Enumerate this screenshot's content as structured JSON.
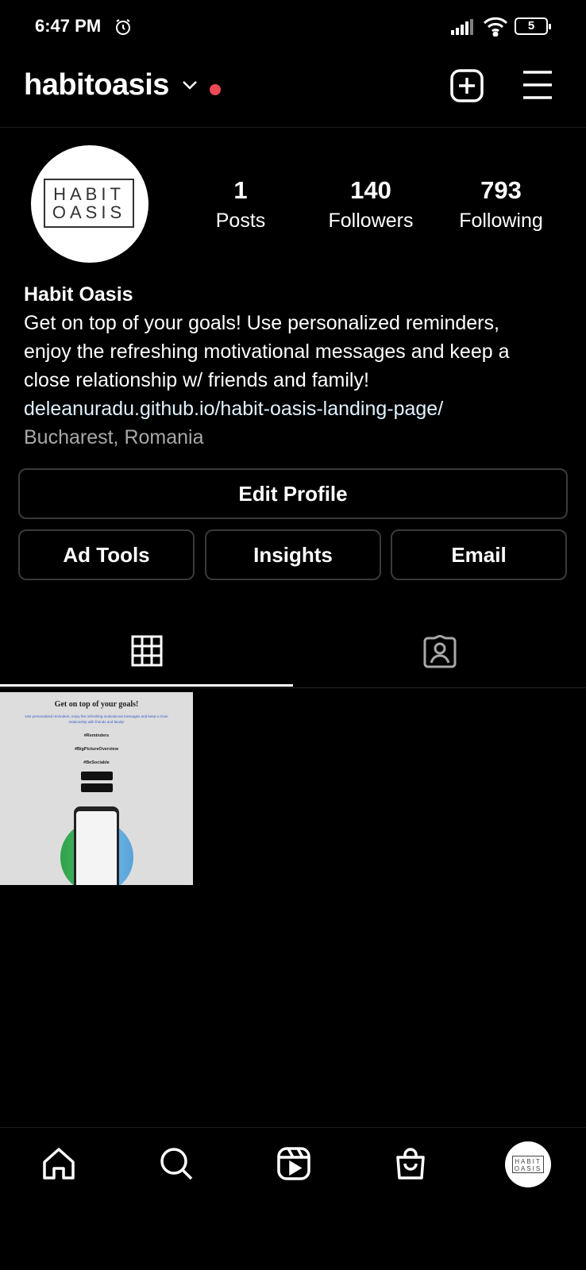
{
  "status_bar": {
    "time": "6:47 PM",
    "battery": "5"
  },
  "header": {
    "username": "habitoasis"
  },
  "profile": {
    "avatar_logo_line1": "HABIT",
    "avatar_logo_line2": "OASIS",
    "stats": [
      {
        "value": "1",
        "label": "Posts"
      },
      {
        "value": "140",
        "label": "Followers"
      },
      {
        "value": "793",
        "label": "Following"
      }
    ],
    "display_name": "Habit Oasis",
    "bio_line1": "Get on top of your goals! Use personalized reminders,",
    "bio_line2": "enjoy the refreshing motivational messages and keep a",
    "bio_line3": "close relationship w/ friends and family!",
    "link": "deleanuradu.github.io/habit-oasis-landing-page/",
    "location": "Bucharest, Romania"
  },
  "buttons": {
    "edit_profile": "Edit Profile",
    "ad_tools": "Ad Tools",
    "insights": "Insights",
    "email": "Email"
  },
  "post": {
    "title": "Get on top of your goals!",
    "subtitle": "Use personalized reminders, enjoy the refreshing motivational messages and keep a close relationship with friends and family!",
    "tags": [
      "#Reminders",
      "#BigPictureOverview",
      "#BeSociable"
    ]
  },
  "colors": {
    "notification_dot": "#ed4956",
    "link": "#e0f1ff",
    "location": "#a8a8a8"
  },
  "icons": {
    "header": [
      "plus-square-icon",
      "hamburger-menu-icon"
    ],
    "tabs": [
      "grid-icon",
      "tagged-person-icon"
    ],
    "nav": [
      "home-icon",
      "search-icon",
      "reels-icon",
      "shop-icon",
      "profile-avatar"
    ]
  }
}
